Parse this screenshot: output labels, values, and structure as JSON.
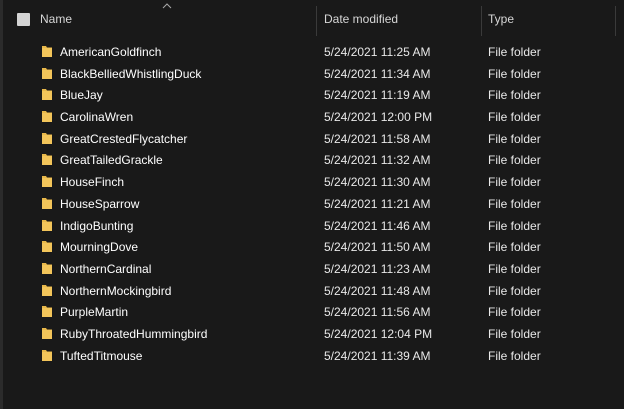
{
  "header": {
    "name": "Name",
    "date_modified": "Date modified",
    "type": "Type",
    "sort_direction": "ascending"
  },
  "colors": {
    "background": "#191919",
    "folder": "#f3c55a"
  },
  "files": [
    {
      "name": "AmericanGoldfinch",
      "date": "5/24/2021 11:25 AM",
      "type": "File folder",
      "icon": "folder-icon"
    },
    {
      "name": "BlackBelliedWhistlingDuck",
      "date": "5/24/2021 11:34 AM",
      "type": "File folder",
      "icon": "folder-icon"
    },
    {
      "name": "BlueJay",
      "date": "5/24/2021 11:19 AM",
      "type": "File folder",
      "icon": "folder-icon"
    },
    {
      "name": "CarolinaWren",
      "date": "5/24/2021 12:00 PM",
      "type": "File folder",
      "icon": "folder-icon"
    },
    {
      "name": "GreatCrestedFlycatcher",
      "date": "5/24/2021 11:58 AM",
      "type": "File folder",
      "icon": "folder-icon"
    },
    {
      "name": "GreatTailedGrackle",
      "date": "5/24/2021 11:32 AM",
      "type": "File folder",
      "icon": "folder-icon"
    },
    {
      "name": "HouseFinch",
      "date": "5/24/2021 11:30 AM",
      "type": "File folder",
      "icon": "folder-icon"
    },
    {
      "name": "HouseSparrow",
      "date": "5/24/2021 11:21 AM",
      "type": "File folder",
      "icon": "folder-icon"
    },
    {
      "name": "IndigoBunting",
      "date": "5/24/2021 11:46 AM",
      "type": "File folder",
      "icon": "folder-icon"
    },
    {
      "name": "MourningDove",
      "date": "5/24/2021 11:50 AM",
      "type": "File folder",
      "icon": "folder-icon"
    },
    {
      "name": "NorthernCardinal",
      "date": "5/24/2021 11:23 AM",
      "type": "File folder",
      "icon": "folder-icon"
    },
    {
      "name": "NorthernMockingbird",
      "date": "5/24/2021 11:48 AM",
      "type": "File folder",
      "icon": "folder-icon"
    },
    {
      "name": "PurpleMartin",
      "date": "5/24/2021 11:56 AM",
      "type": "File folder",
      "icon": "folder-icon"
    },
    {
      "name": "RubyThroatedHummingbird",
      "date": "5/24/2021 12:04 PM",
      "type": "File folder",
      "icon": "folder-icon"
    },
    {
      "name": "TuftedTitmouse",
      "date": "5/24/2021 11:39 AM",
      "type": "File folder",
      "icon": "folder-icon"
    }
  ]
}
